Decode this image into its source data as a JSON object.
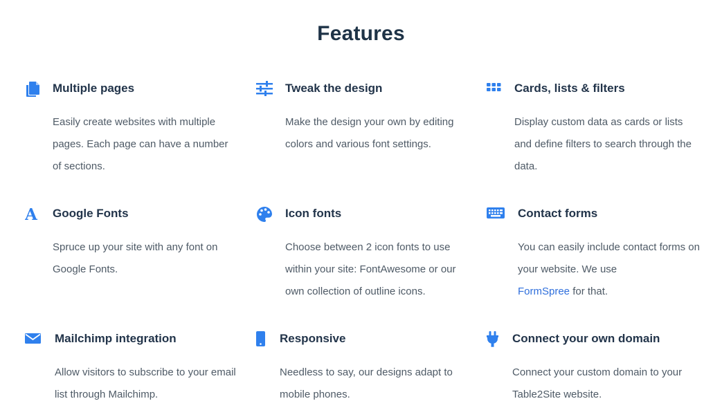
{
  "section": {
    "title": "Features"
  },
  "colors": {
    "accent": "#2f80ed",
    "heading": "#1e3347",
    "body_text": "#4e5a66",
    "link": "#2f6fdc"
  },
  "features": [
    {
      "icon": "file-copy-icon",
      "title": "Multiple pages",
      "description": "Easily create websites with multiple pages. Each page can have a number of sections."
    },
    {
      "icon": "sliders-icon",
      "title": "Tweak the design",
      "description": "Make the design your own by editing colors and various font settings."
    },
    {
      "icon": "grid-icon",
      "title": "Cards, lists & filters",
      "description": "Display custom data as cards or lists and define filters to search through the data."
    },
    {
      "icon": "font-icon",
      "title": "Google Fonts",
      "description": "Spruce up your site with any font on Google Fonts."
    },
    {
      "icon": "palette-icon",
      "title": "Icon fonts",
      "description": "Choose between 2 icon fonts to use within your site: FontAwesome or our own collection of outline icons."
    },
    {
      "icon": "keyboard-icon",
      "title": "Contact forms",
      "description_before": "You can easily include contact forms on your website. We use",
      "link_text": "FormSpree",
      "description_after": "for that."
    },
    {
      "icon": "envelope-icon",
      "title": "Mailchimp integration",
      "description": "Allow visitors to subscribe to your email list through Mailchimp."
    },
    {
      "icon": "mobile-icon",
      "title": "Responsive",
      "description": "Needless to say, our designs adapt to mobile phones."
    },
    {
      "icon": "plug-icon",
      "title": "Connect your own domain",
      "description": "Connect your custom domain to your Table2Site website."
    }
  ]
}
